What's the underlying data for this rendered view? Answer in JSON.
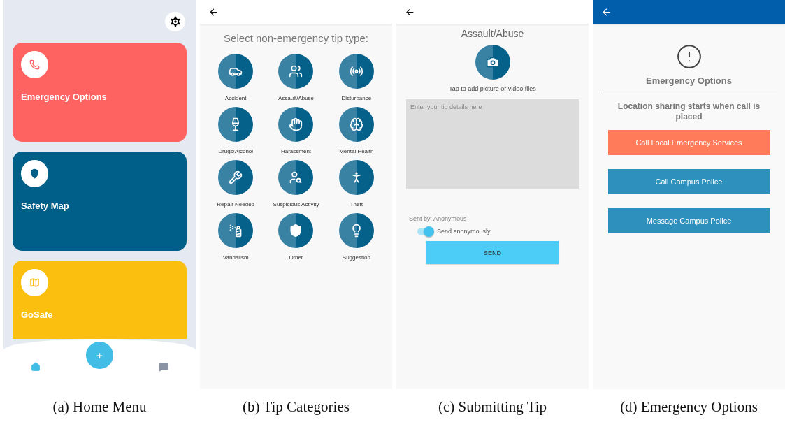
{
  "home": {
    "cards": [
      {
        "label": "Emergency Options",
        "color": "#ff6361"
      },
      {
        "label": "Safety Map",
        "color": "#005f88"
      },
      {
        "label": "GoSafe",
        "color": "#fbbf10"
      }
    ],
    "nav": [
      {
        "kind": "home",
        "selected": true
      },
      {
        "kind": "add",
        "label": "+",
        "selected": false
      },
      {
        "kind": "chat",
        "selected": false
      }
    ],
    "caption": "(a) Home Menu"
  },
  "categories": {
    "title": "Select non-emergency tip type:",
    "items": [
      "Accident",
      "Assault/Abuse",
      "Disturbance",
      "Drugs/Alcohol",
      "Harassment",
      "Mental Health",
      "Repair Needed",
      "Suspicious Activity",
      "Theft",
      "Vandalism",
      "Other",
      "Suggestion"
    ],
    "caption": "(b) Tip Categories"
  },
  "submit": {
    "title": "Assault/Abuse",
    "media_hint": "Tap to add picture or video files",
    "details": {
      "placeholder": "Enter your tip details here"
    },
    "sent_by": "Sent by: Anonymous",
    "anonymous": {
      "label": "Send anonymously",
      "on": true
    },
    "send_button": "SEND",
    "caption": "(c) Submitting Tip"
  },
  "emergency": {
    "title": "Emergency Options",
    "note": "Location sharing starts when call is placed",
    "buttons": [
      {
        "label": "Call Local Emergency Services",
        "color": "#ff7b59"
      },
      {
        "label": "Call Campus Police",
        "color": "#2e90bd"
      },
      {
        "label": "Message Campus Police",
        "color": "#2e90bd"
      }
    ],
    "caption": "(d) Emergency Options"
  }
}
